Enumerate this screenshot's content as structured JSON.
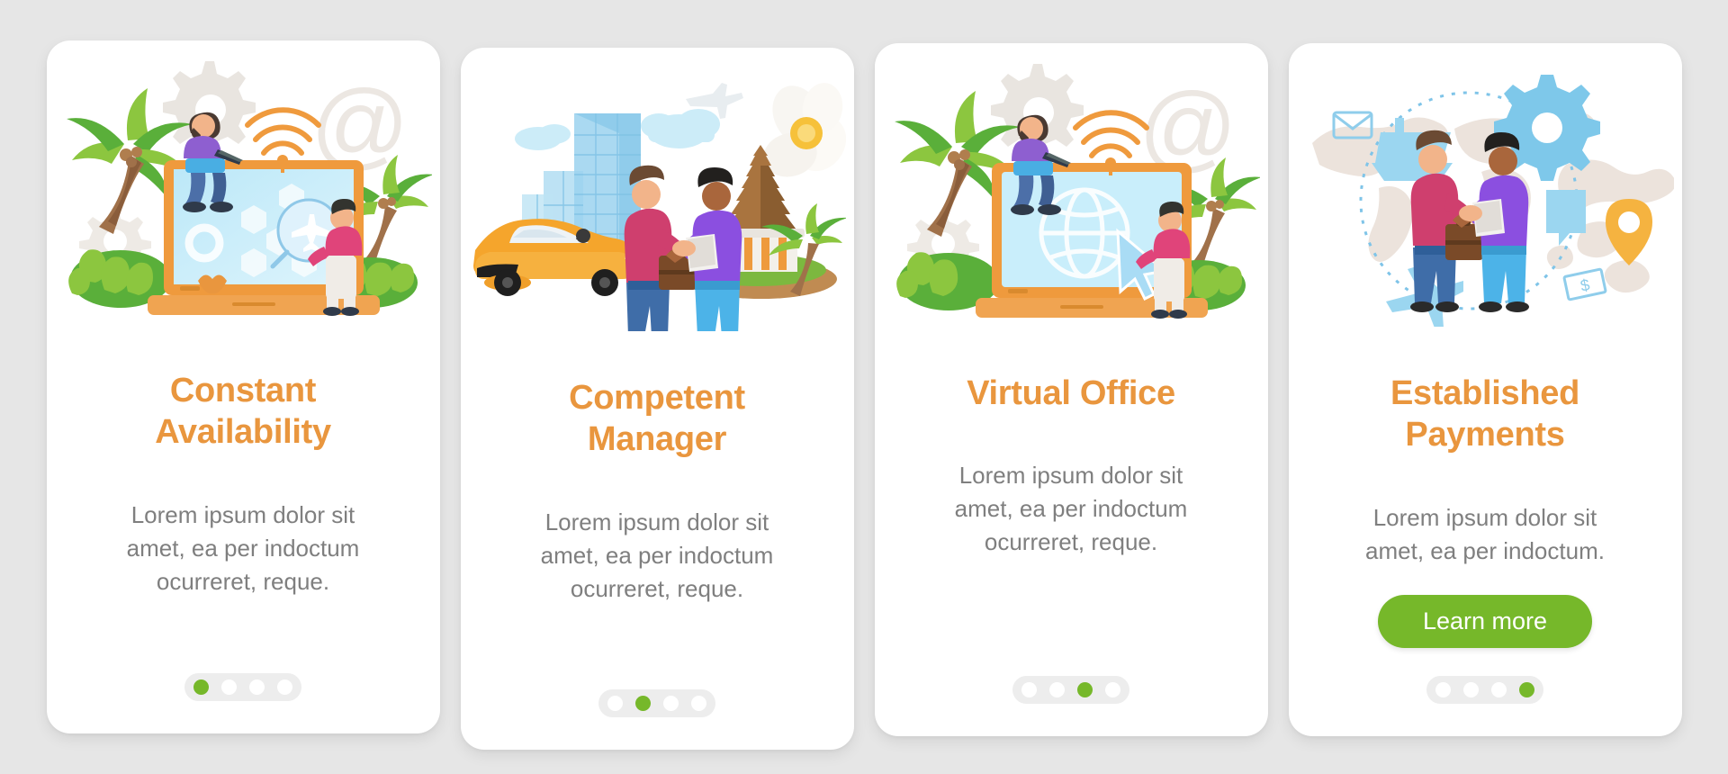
{
  "background_color": "#e6e6e6",
  "theme": {
    "title_color": "#e9963e",
    "body_color": "#7f7f7f",
    "accent_green": "#76b82a",
    "card_bg": "#ffffff",
    "pager_bg": "#ededed",
    "dot_inactive": "#ffffff"
  },
  "screens": [
    {
      "id": "constant-availability",
      "title": "Constant\nAvailability",
      "body": "Lorem ipsum dolor sit\namet, ea per indoctum\nocurreret, reque.",
      "illustration": "laptop-palm-search-illustration",
      "pagination": {
        "total": 4,
        "active": 1
      },
      "cta": null
    },
    {
      "id": "competent-manager",
      "title": "Competent\nManager",
      "body": "Lorem ipsum dolor sit\namet, ea per indoctum\nocurreret, reque.",
      "illustration": "handshake-car-temple-illustration",
      "pagination": {
        "total": 4,
        "active": 2
      },
      "cta": null
    },
    {
      "id": "virtual-office",
      "title": "Virtual Office",
      "body": "Lorem ipsum dolor sit\namet, ea per indoctum\nocurreret, reque.",
      "illustration": "laptop-globe-cursor-illustration",
      "pagination": {
        "total": 4,
        "active": 3
      },
      "cta": null
    },
    {
      "id": "established-payments",
      "title": "Established\nPayments",
      "body": "Lorem ipsum dolor sit\namet, ea per indoctum.",
      "illustration": "world-map-handshake-illustration",
      "pagination": {
        "total": 4,
        "active": 4
      },
      "cta": {
        "label": "Learn more",
        "color": "#76b82a"
      }
    }
  ]
}
